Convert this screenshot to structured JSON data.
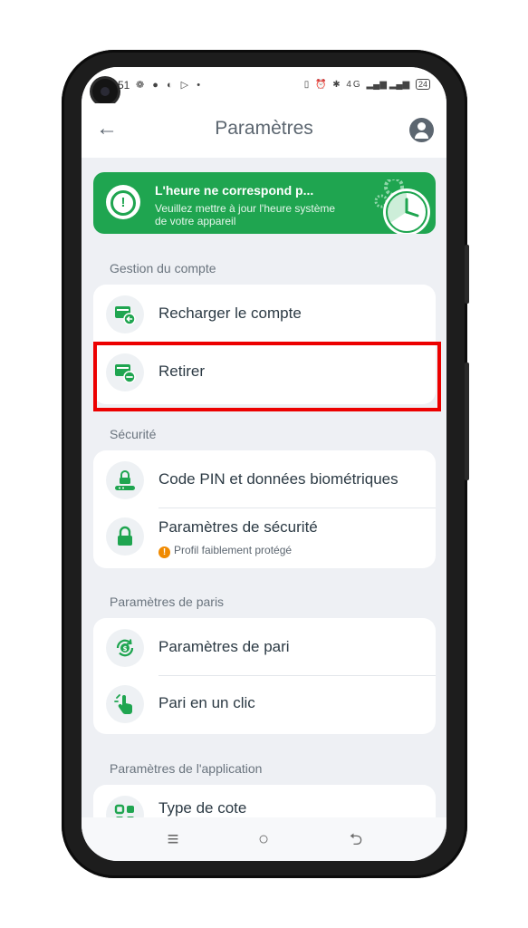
{
  "statusbar": {
    "time": "51",
    "left_icons": "❁ ● ◐ ▷ •",
    "right_icons": "▯ ⏰ ✱ 4G",
    "battery": "24"
  },
  "header": {
    "back_icon": "arrow-left-icon",
    "title": "Paramètres",
    "profile_icon": "user-circle-icon"
  },
  "banner": {
    "title": "L'heure ne correspond p...",
    "subtitle": "Veuillez mettre à jour l'heure système de votre appareil",
    "alert_icon": "exclamation-icon",
    "illustration_icon": "clock-gears-icon",
    "color": "#1fa550"
  },
  "sections": {
    "account": {
      "label": "Gestion du compte",
      "items": [
        {
          "label": "Recharger le compte",
          "icon": "wallet-deposit-icon"
        },
        {
          "label": "Retirer",
          "icon": "wallet-withdraw-icon"
        }
      ]
    },
    "security": {
      "label": "Sécurité",
      "items": [
        {
          "label": "Code PIN et données biométriques",
          "icon": "pin-lock-icon"
        },
        {
          "label": "Paramètres de sécurité",
          "sub": "Profil faiblement protégé",
          "icon": "lock-icon"
        }
      ]
    },
    "betting": {
      "label": "Paramètres de paris",
      "items": [
        {
          "label": "Paramètres de pari",
          "icon": "coin-cycle-icon"
        },
        {
          "label": "Pari en un clic",
          "icon": "tap-finger-icon"
        }
      ]
    },
    "app": {
      "label": "Paramètres de l'application",
      "items": [
        {
          "label": "Type de cote",
          "icon": "grid-icon"
        }
      ]
    }
  },
  "navbar": {
    "menu": "≡",
    "home": "○",
    "back": "⮌"
  },
  "colors": {
    "accent": "#1fa550",
    "highlight": "#ec0000",
    "warning": "#f08a00"
  }
}
